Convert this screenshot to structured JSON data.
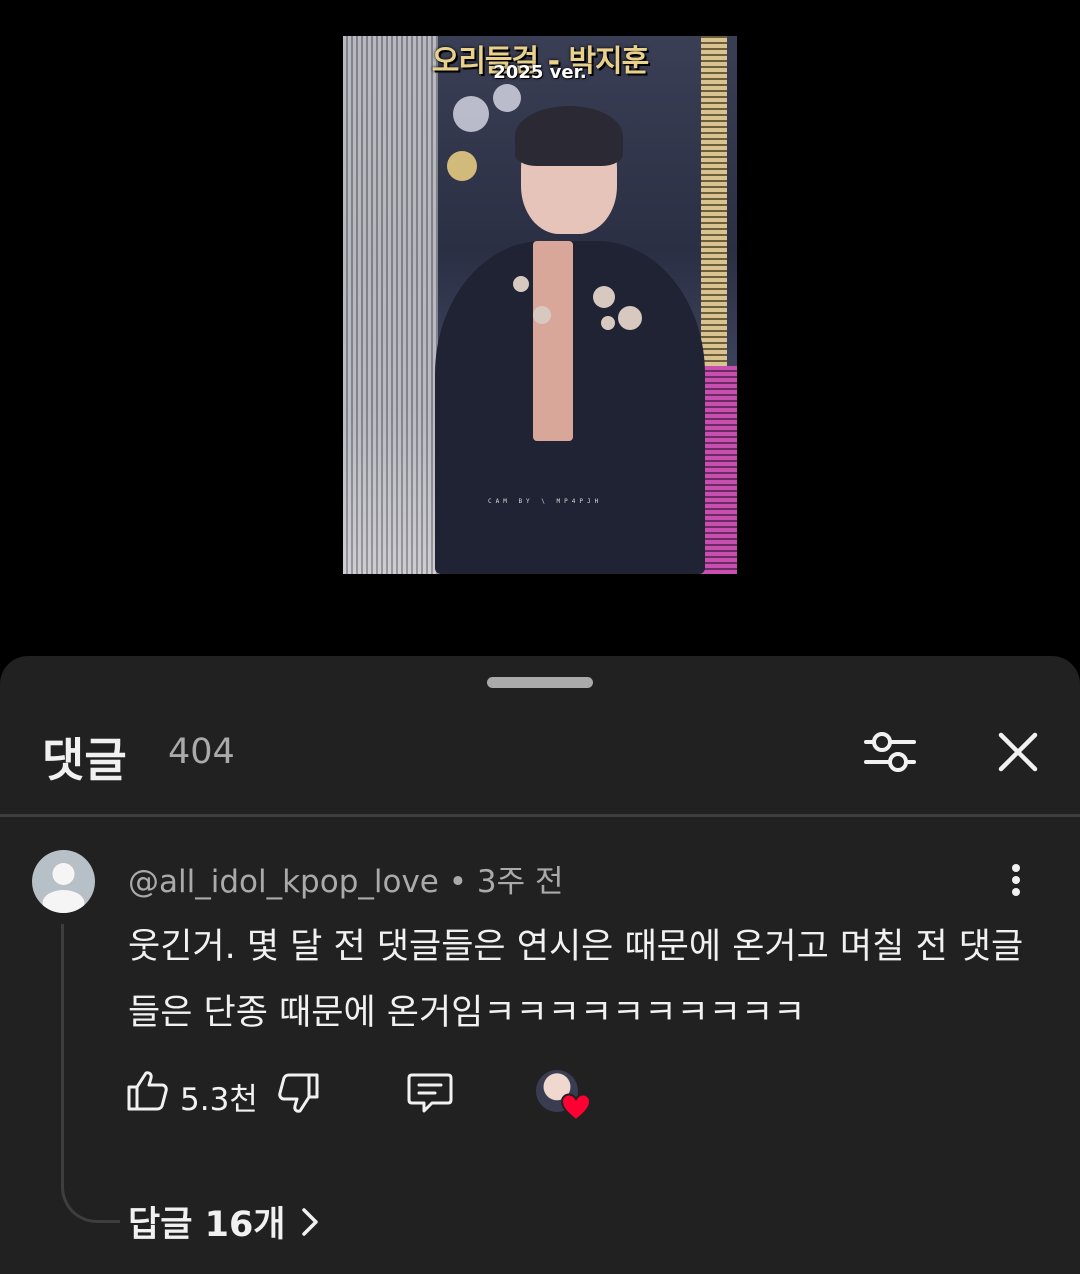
{
  "video": {
    "title": "오리들걸 - 박지훈",
    "subtitle": "2025 ver.",
    "watermark": "CAM BY  \\  MP4PJH"
  },
  "comments": {
    "title": "댓글",
    "count": "404",
    "filter_icon": "sliders-icon",
    "close_icon": "close-icon",
    "items": [
      {
        "author": "@all_idol_kpop_love",
        "separator": " • ",
        "time": "3주 전",
        "text": "웃긴거. 몇 달 전 댓글들은 연시은 때문에 온거고 며칠 전 댓글들은 단종 때문에 온거임ㅋㅋㅋㅋㅋㅋㅋㅋㅋㅋ",
        "likes": "5.3천",
        "replies": "답글 16개"
      }
    ]
  },
  "colors": {
    "background": "#000000",
    "sheet": "#212121",
    "text_primary": "#f1f1f1",
    "text_secondary": "#aaaaaa",
    "heart": "#ff0033"
  }
}
